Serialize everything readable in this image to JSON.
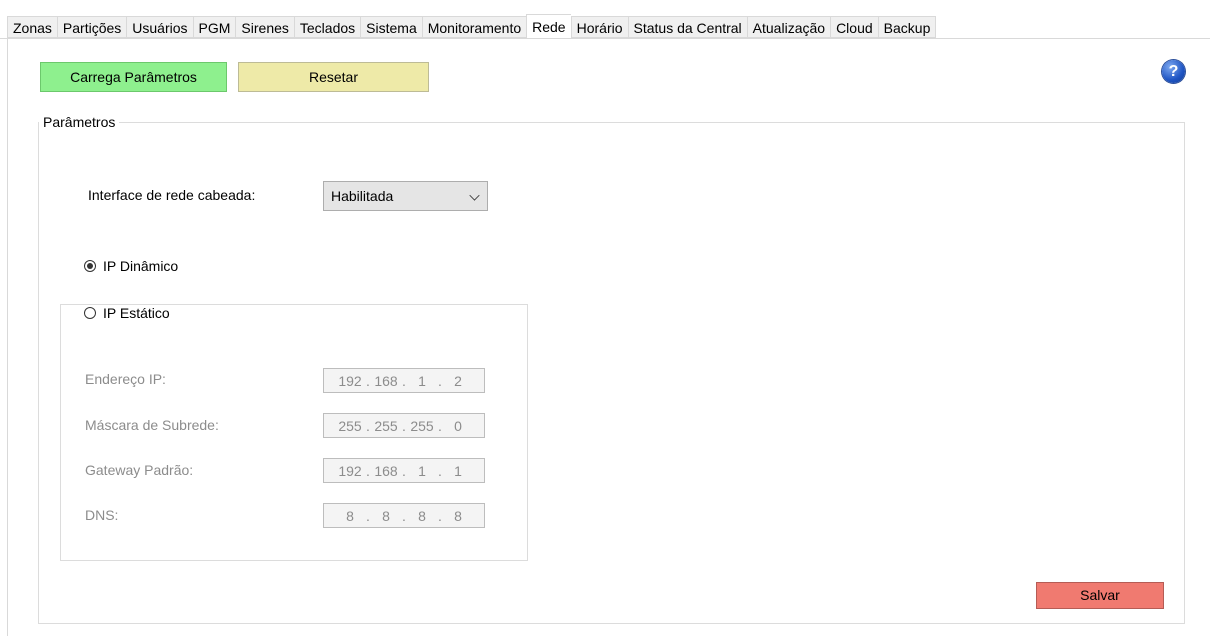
{
  "tabs": [
    {
      "label": "Zonas",
      "active": false
    },
    {
      "label": "Partições",
      "active": false
    },
    {
      "label": "Usuários",
      "active": false
    },
    {
      "label": "PGM",
      "active": false
    },
    {
      "label": "Sirenes",
      "active": false
    },
    {
      "label": "Teclados",
      "active": false
    },
    {
      "label": "Sistema",
      "active": false
    },
    {
      "label": "Monitoramento",
      "active": false
    },
    {
      "label": "Rede",
      "active": true
    },
    {
      "label": "Horário",
      "active": false
    },
    {
      "label": "Status da Central",
      "active": false
    },
    {
      "label": "Atualização",
      "active": false
    },
    {
      "label": "Cloud",
      "active": false
    },
    {
      "label": "Backup",
      "active": false
    }
  ],
  "toolbar": {
    "load_label": "Carrega Parâmetros",
    "reset_label": "Resetar",
    "help_icon": "help-icon"
  },
  "params": {
    "legend": "Parâmetros",
    "wired_interface_label": "Interface de rede cabeada:",
    "wired_interface_value": "Habilitada",
    "dynamic_ip_label": "IP Dinâmico",
    "dynamic_ip_selected": true,
    "static_ip_label": "IP Estático",
    "static_ip_selected": false,
    "fields": [
      {
        "label": "Endereço IP:",
        "octets": [
          "192",
          "168",
          "1",
          "2"
        ]
      },
      {
        "label": "Máscara de Subrede:",
        "octets": [
          "255",
          "255",
          "255",
          "0"
        ]
      },
      {
        "label": "Gateway Padrão:",
        "octets": [
          "192",
          "168",
          "1",
          "1"
        ]
      },
      {
        "label": "DNS:",
        "octets": [
          "8",
          "8",
          "8",
          "8"
        ]
      }
    ],
    "save_label": "Salvar"
  },
  "colors": {
    "load_button": "#8ef08e",
    "reset_button": "#eeeaa8",
    "save_button": "#f07a70"
  }
}
